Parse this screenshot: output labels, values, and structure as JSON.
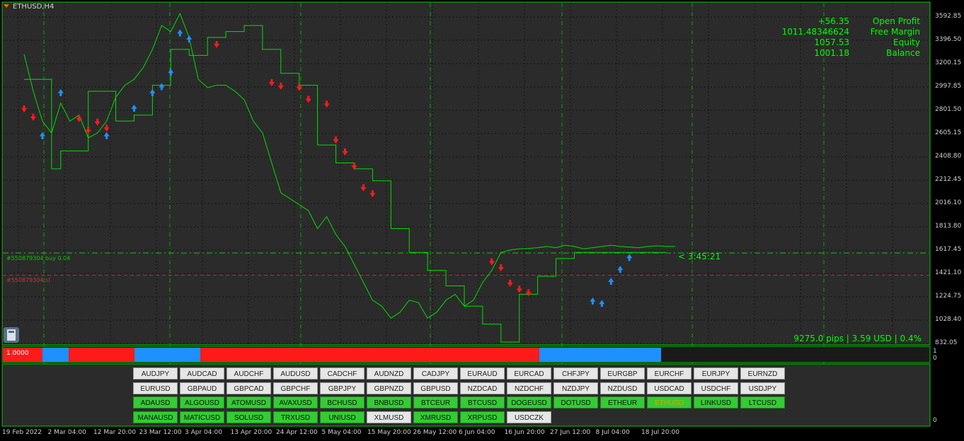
{
  "chart": {
    "symbol": "ETHUSD,H4",
    "y_labels": [
      "3592.85",
      "3396.50",
      "3200.15",
      "2997.85",
      "2801.50",
      "2605.15",
      "2408.80",
      "2212.45",
      "2016.10",
      "1813.80",
      "1617.45",
      "1421.10",
      "1224.75",
      "1028.40",
      "832.05"
    ],
    "x_labels": [
      "19 Feb 2022",
      "2 Mar 04:00",
      "12 Mar 20:00",
      "23 Mar 12:00",
      "3 Apr 04:00",
      "13 Apr 20:00",
      "24 Apr 12:00",
      "5 May 04:00",
      "15 May 20:00",
      "26 May 12:00",
      "6 Jun 04:00",
      "16 Jun 20:00",
      "27 Jun 12:00",
      "8 Jul 04:00",
      "18 Jul 20:00"
    ],
    "trade_line": "#550879304 buy 0.04",
    "sl_line": "#550879304 sl",
    "timer": "< 3:45:21",
    "pips_summary": "9275.0 pips | 3.59 USD | 0.4%",
    "colors": {
      "grid": "#00cc00",
      "price": "#00dd00",
      "buy": "#1e90ff",
      "sell": "#ff1a1a",
      "background": "#000000"
    }
  },
  "account": {
    "values": [
      "+56.35",
      "1011.48346624",
      "1057.53",
      "1001.18"
    ],
    "labels": [
      "Open Profit",
      "Free Margin",
      "Equity",
      "Balance"
    ]
  },
  "indicator": {
    "label": "1.0000",
    "axis_top": "1",
    "axis_bottom": "0",
    "segments": [
      {
        "state": "sell",
        "from": 0.0,
        "to": 0.06
      },
      {
        "state": "buy",
        "from": 0.06,
        "to": 0.1
      },
      {
        "state": "sell",
        "from": 0.1,
        "to": 0.2
      },
      {
        "state": "buy",
        "from": 0.2,
        "to": 0.3
      },
      {
        "state": "sell",
        "from": 0.3,
        "to": 0.815
      },
      {
        "state": "buy",
        "from": 0.815,
        "to": 1.0
      }
    ]
  },
  "panel": {
    "axis_label": "0",
    "buttons": [
      {
        "label": "AUDJPY",
        "state": "gray"
      },
      {
        "label": "AUDCAD",
        "state": "gray"
      },
      {
        "label": "AUDCHF",
        "state": "gray"
      },
      {
        "label": "AUDUSD",
        "state": "gray"
      },
      {
        "label": "CADCHF",
        "state": "gray"
      },
      {
        "label": "AUDNZD",
        "state": "gray"
      },
      {
        "label": "CADJPY",
        "state": "gray"
      },
      {
        "label": "EURAUD",
        "state": "gray"
      },
      {
        "label": "EURCAD",
        "state": "gray"
      },
      {
        "label": "CHFJPY",
        "state": "gray"
      },
      {
        "label": "EURGBP",
        "state": "gray"
      },
      {
        "label": "EURCHF",
        "state": "gray"
      },
      {
        "label": "EURJPY",
        "state": "gray"
      },
      {
        "label": "EURNZD",
        "state": "gray"
      },
      {
        "label": "EURUSD",
        "state": "gray"
      },
      {
        "label": "GBPAUD",
        "state": "gray"
      },
      {
        "label": "GBPCAD",
        "state": "gray"
      },
      {
        "label": "GBPCHF",
        "state": "gray"
      },
      {
        "label": "GBPJPY",
        "state": "gray"
      },
      {
        "label": "GBPNZD",
        "state": "gray"
      },
      {
        "label": "GBPUSD",
        "state": "gray"
      },
      {
        "label": "NZDCAD",
        "state": "gray"
      },
      {
        "label": "NZDCHF",
        "state": "gray"
      },
      {
        "label": "NZDJPY",
        "state": "gray"
      },
      {
        "label": "NZDUSD",
        "state": "gray"
      },
      {
        "label": "USDCAD",
        "state": "gray"
      },
      {
        "label": "USDCHF",
        "state": "gray"
      },
      {
        "label": "USDJPY",
        "state": "gray"
      },
      {
        "label": "ADAUSD",
        "state": "green"
      },
      {
        "label": "ALGOUSD",
        "state": "green"
      },
      {
        "label": "ATOMUSD",
        "state": "green"
      },
      {
        "label": "AVAXUSD",
        "state": "green"
      },
      {
        "label": "BCHUSD",
        "state": "green"
      },
      {
        "label": "BNBUSD",
        "state": "green"
      },
      {
        "label": "BTCEUR",
        "state": "green"
      },
      {
        "label": "BTCUSD",
        "state": "green"
      },
      {
        "label": "DOGEUSD",
        "state": "green"
      },
      {
        "label": "DOTUSD",
        "state": "green"
      },
      {
        "label": "ETHEUR",
        "state": "green"
      },
      {
        "label": "ETHUSD",
        "state": "active"
      },
      {
        "label": "LINKUSD",
        "state": "green"
      },
      {
        "label": "LTCUSD",
        "state": "green"
      },
      {
        "label": "MANAUSD",
        "state": "green"
      },
      {
        "label": "MATICUSD",
        "state": "green"
      },
      {
        "label": "SOLUSD",
        "state": "green"
      },
      {
        "label": "TRXUSD",
        "state": "green"
      },
      {
        "label": "UNIUSD",
        "state": "green"
      },
      {
        "label": "XLMUSD",
        "state": "gray"
      },
      {
        "label": "XMRUSD",
        "state": "green"
      },
      {
        "label": "XRPUSD",
        "state": "green"
      },
      {
        "label": "USDCZK",
        "state": "gray"
      }
    ]
  },
  "chart_data": {
    "type": "line",
    "title": "ETHUSD,H4",
    "xlabel": "",
    "ylabel": "",
    "ylim": [
      832.05,
      3690
    ],
    "grid": true,
    "x_range": [
      0,
      100
    ],
    "series": [
      {
        "name": "",
        "x": [
          0,
          1,
          2,
          3,
          4,
          5,
          6,
          7,
          8,
          9,
          10,
          11,
          12,
          13,
          14,
          15,
          16,
          17,
          18,
          19,
          20,
          21,
          22,
          23,
          24,
          25,
          26,
          27,
          28,
          29,
          30,
          31,
          32,
          33,
          34,
          35,
          36,
          37,
          38,
          39,
          40,
          41,
          42,
          43,
          44,
          45,
          46,
          47,
          48,
          49,
          50,
          51,
          52,
          53,
          54,
          55,
          56,
          57,
          58,
          59,
          60,
          61,
          62,
          63,
          64,
          65,
          66,
          67,
          68,
          69,
          70,
          71
        ],
        "values": [
          3260,
          2950,
          2700,
          2600,
          2850,
          2700,
          2750,
          2560,
          2600,
          2700,
          2900,
          3000,
          3050,
          3150,
          3300,
          3500,
          3450,
          3600,
          3400,
          3050,
          2980,
          3000,
          3000,
          2950,
          2880,
          2700,
          2600,
          2350,
          2100,
          2050,
          2000,
          1950,
          1800,
          1900,
          1750,
          1650,
          1500,
          1350,
          1200,
          1150,
          1050,
          1100,
          1200,
          1180,
          1050,
          1100,
          1200,
          1250,
          1150,
          1200,
          1350,
          1450,
          1600,
          1620,
          1630,
          1633,
          1640,
          1650,
          1640,
          1660,
          1650,
          1630,
          1640,
          1650,
          1660,
          1650,
          1645,
          1640,
          1650,
          1655,
          1650,
          1650
        ]
      },
      {
        "name": "",
        "x": [
          0,
          3,
          4,
          7,
          10,
          12,
          14,
          16,
          18,
          20,
          22,
          24,
          26,
          28,
          30,
          32,
          34,
          36,
          38,
          40,
          42,
          44,
          46,
          48,
          50,
          52,
          54,
          56,
          58,
          60,
          62,
          64,
          66,
          68,
          70
        ],
        "values": [
          3050,
          2300,
          2450,
          2950,
          2700,
          2750,
          3000,
          3300,
          3250,
          3400,
          3450,
          3500,
          3300,
          3100,
          3000,
          2500,
          2350,
          2300,
          2200,
          1800,
          1600,
          1450,
          1320,
          1150,
          1000,
          850,
          1250,
          1400,
          1550,
          1600,
          1600,
          1600,
          1600,
          1600,
          1600
        ]
      }
    ],
    "buy_signals": [
      [
        2,
        2620
      ],
      [
        4,
        2980
      ],
      [
        9,
        2620
      ],
      [
        12,
        2850
      ],
      [
        14,
        2980
      ],
      [
        15,
        3030
      ],
      [
        16,
        3150
      ],
      [
        17,
        3480
      ],
      [
        18,
        3430
      ],
      [
        62,
        1235
      ],
      [
        63,
        1215
      ],
      [
        64,
        1400
      ],
      [
        65,
        1500
      ],
      [
        66,
        1600
      ]
    ],
    "sell_signals": [
      [
        0,
        2760
      ],
      [
        1,
        2690
      ],
      [
        6,
        2680
      ],
      [
        7,
        2580
      ],
      [
        8,
        2650
      ],
      [
        9,
        2600
      ],
      [
        21,
        3300
      ],
      [
        27,
        2980
      ],
      [
        28,
        2950
      ],
      [
        30,
        2940
      ],
      [
        31,
        2840
      ],
      [
        33,
        2800
      ],
      [
        34,
        2500
      ],
      [
        35,
        2400
      ],
      [
        36,
        2280
      ],
      [
        37,
        2100
      ],
      [
        38,
        2050
      ],
      [
        51,
        1480
      ],
      [
        52,
        1430
      ],
      [
        53,
        1300
      ],
      [
        54,
        1250
      ],
      [
        55,
        1220
      ]
    ],
    "horizontal_lines": [
      {
        "label": "#550879304 buy 0.04",
        "y": 1595
      },
      {
        "label": "#550879304 sl",
        "y": 1410
      }
    ]
  }
}
